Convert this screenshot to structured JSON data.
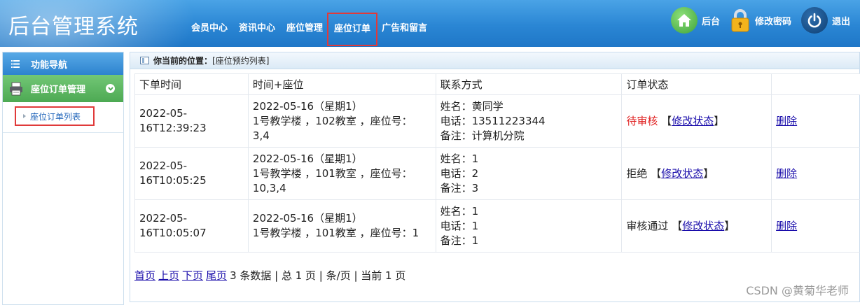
{
  "header": {
    "title": "后台管理系统",
    "nav": [
      "会员中心",
      "资讯中心",
      "座位管理",
      "座位订单",
      "广告和留言"
    ],
    "active_nav": "座位订单",
    "home_label": "后台",
    "password_label": "修改密码",
    "logout_label": "退出"
  },
  "sidebar": {
    "nav_title": "功能导航",
    "group_label": "座位订单管理",
    "sub_item": "座位订单列表"
  },
  "breadcrumb": {
    "label": "你当前的位置：",
    "path": "[座位预约列表]"
  },
  "table": {
    "headers": [
      "下单时间",
      "时间+座位",
      "联系方式",
      "订单状态",
      ""
    ],
    "rows": [
      {
        "time_line1": "2022-05-",
        "time_line2": "16T12:39:23",
        "seat_line1": "2022-05-16（星期1）",
        "seat_line2": "1号教学楼 ，102教室 ，座位号：",
        "seat_line3": "3,4",
        "name": "姓名：黄同学",
        "phone": "电话：13511223344",
        "note": "备注：计算机分院",
        "status": "待审核",
        "status_color": "#e02020",
        "edit": "修改状态",
        "delete": "删除"
      },
      {
        "time_line1": "2022-05-",
        "time_line2": "16T10:05:25",
        "seat_line1": "2022-05-16（星期1）",
        "seat_line2": "1号教学楼 ，101教室 ，座位号：",
        "seat_line3": "10,3,4",
        "name": "姓名：1",
        "phone": "电话：2",
        "note": "备注：3",
        "status": "拒绝",
        "status_color": "#222222",
        "edit": "修改状态",
        "delete": "删除"
      },
      {
        "time_line1": "2022-05-",
        "time_line2": "16T10:05:07",
        "seat_line1": "2022-05-16（星期1）",
        "seat_line2": "1号教学楼 ，101教室 ，座位号：1",
        "seat_line3": "",
        "name": "姓名：1",
        "phone": "电话：1",
        "note": "备注：1",
        "status": "审核通过",
        "status_color": "#222222",
        "edit": "修改状态",
        "delete": "删除"
      }
    ]
  },
  "pager": {
    "first": "首页",
    "prev": "上页",
    "next": "下页",
    "last": "尾页",
    "summary": "3 条数据 | 总 1 页 | 条/页 | 当前 1 页"
  },
  "watermark": "CSDN @黄菊华老师",
  "icons": {
    "home": "home-icon",
    "password": "lock-icon",
    "logout": "power-icon",
    "nav": "list-icon",
    "group": "printer-icon",
    "chevron": "chevron-down-icon",
    "breadcrumb": "document-icon"
  }
}
